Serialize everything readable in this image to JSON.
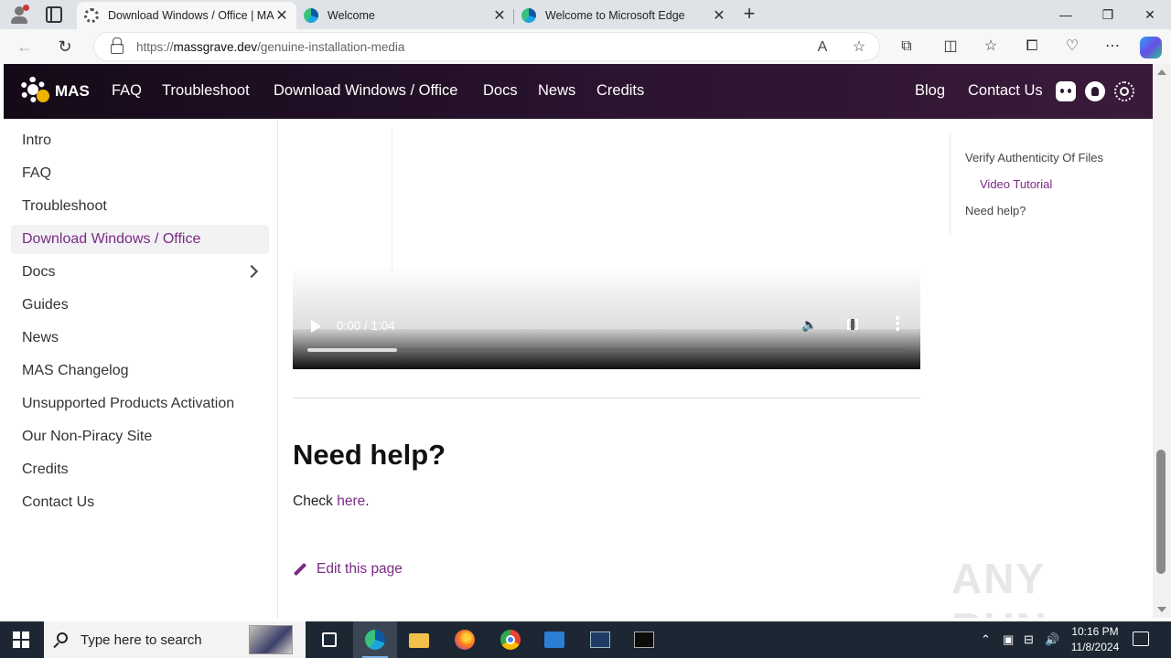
{
  "browser": {
    "tabs": [
      {
        "title": "Download Windows / Office | MA",
        "active": true
      },
      {
        "title": "Welcome",
        "active": false
      },
      {
        "title": "Welcome to Microsoft Edge",
        "active": false
      }
    ],
    "address": {
      "scheme": "https://",
      "host": "massgrave.dev",
      "path": "/genuine-installation-media"
    }
  },
  "site": {
    "brand": "MAS",
    "nav_left": [
      "FAQ",
      "Troubleshoot",
      "Download Windows / Office",
      "Docs",
      "News",
      "Credits"
    ],
    "nav_right": [
      "Blog",
      "Contact Us"
    ],
    "accent_color": "#7a2a83"
  },
  "sidebar": {
    "items": [
      {
        "label": "Intro"
      },
      {
        "label": "FAQ"
      },
      {
        "label": "Troubleshoot"
      },
      {
        "label": "Download Windows / Office",
        "active": true
      },
      {
        "label": "Docs",
        "expandable": true
      },
      {
        "label": "Guides"
      },
      {
        "label": "News"
      },
      {
        "label": "MAS Changelog"
      },
      {
        "label": "Unsupported Products Activation"
      },
      {
        "label": "Our Non-Piracy Site"
      },
      {
        "label": "Credits"
      },
      {
        "label": "Contact Us"
      }
    ]
  },
  "video": {
    "time": "0:00 / 1:04",
    "progress_buffered": 0.15
  },
  "content": {
    "heading": "Need help?",
    "para_prefix": "Check ",
    "para_link": "here",
    "para_suffix": ".",
    "edit_link": "Edit this page"
  },
  "toc": {
    "items": [
      {
        "label": "Verify Authenticity Of Files",
        "sub": false
      },
      {
        "label": "Video Tutorial",
        "sub": true
      },
      {
        "label": "Need help?",
        "sub": false
      }
    ]
  },
  "watermark": "ANY RUN",
  "taskbar": {
    "search_placeholder": "Type here to search",
    "time": "10:16 PM",
    "date": "11/8/2024"
  }
}
